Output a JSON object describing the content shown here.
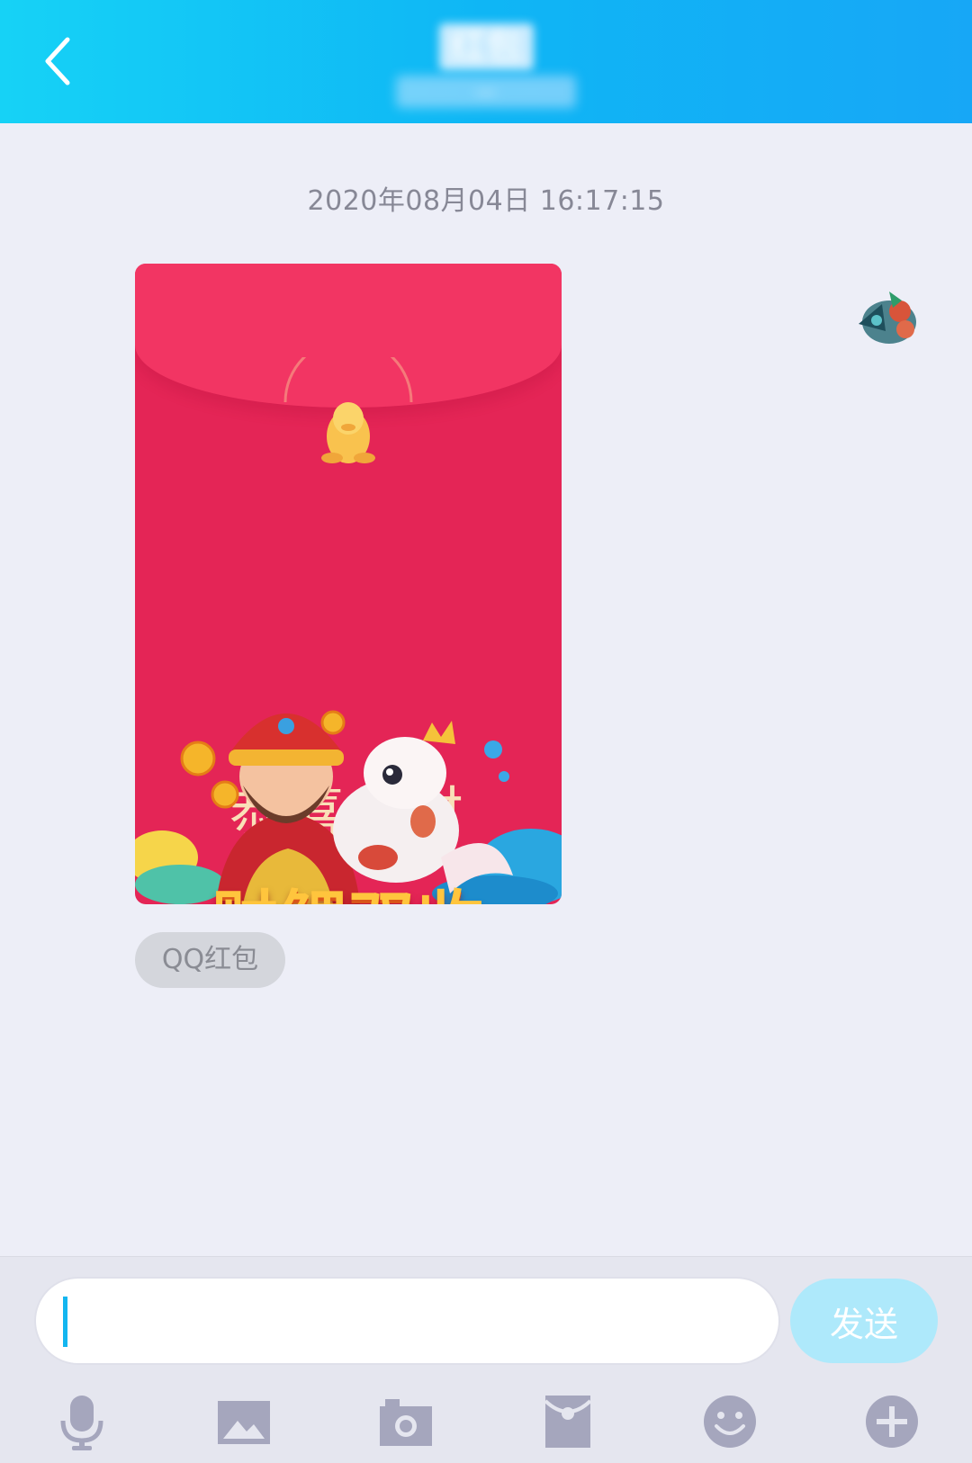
{
  "header": {
    "title": "红包",
    "subtitle": "—"
  },
  "chat": {
    "timestamp": "2020年08月04日 16:17:15",
    "redpacket": {
      "line1": "恭喜发财",
      "line2": "财鲤双收",
      "label": "QQ红包"
    }
  },
  "input": {
    "placeholder": "",
    "send_label": "发送"
  },
  "toolbar": {
    "icons": [
      "microphone-icon",
      "image-icon",
      "camera-icon",
      "red-packet-icon",
      "emoji-icon",
      "plus-icon"
    ]
  },
  "colors": {
    "header_start": "#16d2f6",
    "header_end": "#17a7f6",
    "background": "#edeef7",
    "redpacket": "#e42556",
    "send_button": "#aee9fb",
    "toolbar_icon": "#a5a6bd"
  }
}
